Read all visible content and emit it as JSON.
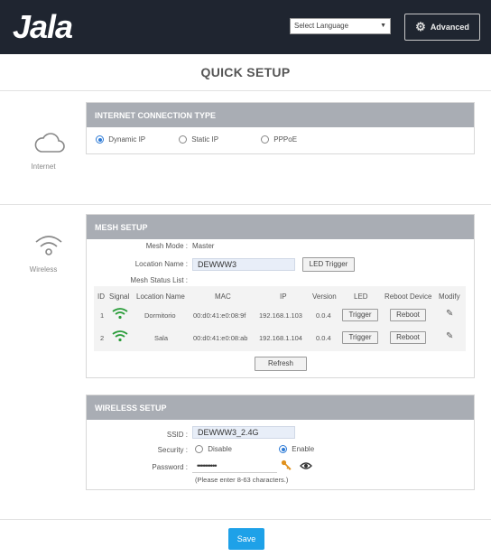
{
  "header": {
    "logo": "Jala",
    "language_select": "Select Language",
    "advanced_label": "Advanced"
  },
  "page_title": "QUICK SETUP",
  "internet": {
    "side_label": "Internet",
    "panel_title": "INTERNET CONNECTION TYPE",
    "options": [
      {
        "label": "Dynamic IP",
        "selected": true
      },
      {
        "label": "Static IP",
        "selected": false
      },
      {
        "label": "PPPoE",
        "selected": false
      }
    ]
  },
  "wireless": {
    "side_label": "Wireless"
  },
  "mesh": {
    "panel_title": "MESH SETUP",
    "mode_label": "Mesh Mode :",
    "mode_value": "Master",
    "location_label": "Location Name :",
    "location_value": "DEWWW3",
    "led_trigger_label": "LED Trigger",
    "status_list_label": "Mesh Status List :",
    "columns": [
      "ID",
      "Signal",
      "Location Name",
      "MAC",
      "IP",
      "Version",
      "LED",
      "Reboot Device",
      "Modify"
    ],
    "rows": [
      {
        "id": "1",
        "location": "Dormitorio",
        "mac": "00:d0:41:e0:08:9f",
        "ip": "192.168.1.103",
        "version": "0.0.4",
        "led": "Trigger",
        "reboot": "Reboot"
      },
      {
        "id": "2",
        "location": "Sala",
        "mac": "00:d0:41:e0:08:ab",
        "ip": "192.168.1.104",
        "version": "0.0.4",
        "led": "Trigger",
        "reboot": "Reboot"
      }
    ],
    "refresh_label": "Refresh"
  },
  "wireless_setup": {
    "panel_title": "WIRELESS SETUP",
    "ssid_label": "SSID :",
    "ssid_value": "DEWWW3_2.4G",
    "security_label": "Security :",
    "security_options": [
      {
        "label": "Disable",
        "selected": false
      },
      {
        "label": "Enable",
        "selected": true
      }
    ],
    "password_label": "Password :",
    "password_value": "••••••••••",
    "hint": "(Please enter 8-63 characters.)"
  },
  "save_label": "Save",
  "colors": {
    "header_bg": "#1f2530",
    "panel_head": "#a9adb4",
    "accent_blue": "#2e7bd6",
    "signal_green": "#2a9d3a",
    "save_blue": "#1ea1e8",
    "key_orange": "#e0901b"
  }
}
